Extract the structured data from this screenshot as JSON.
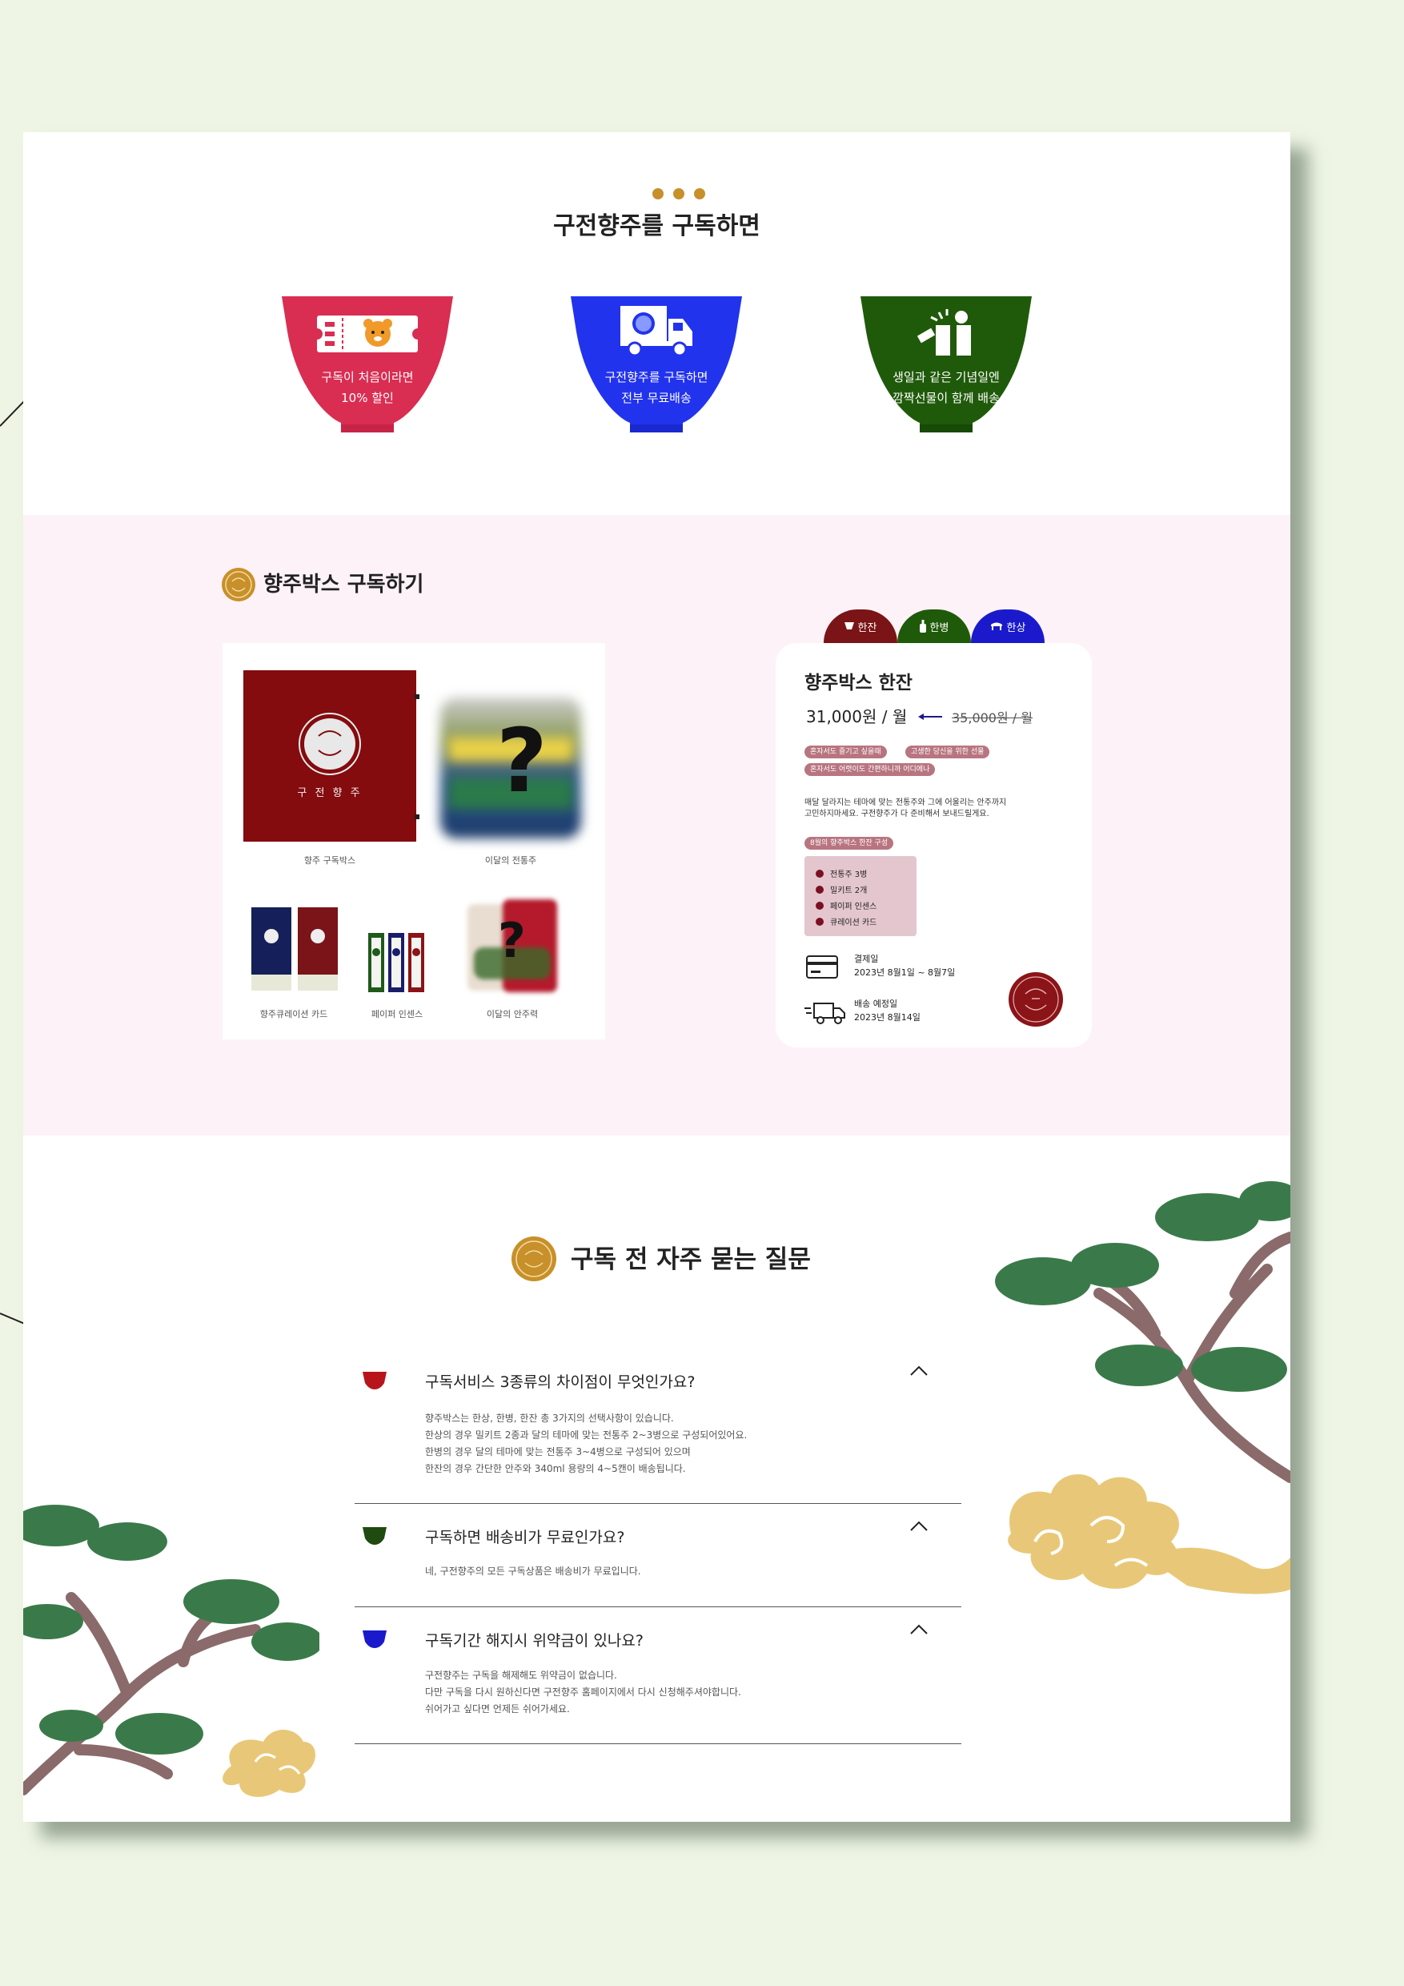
{
  "benefits": {
    "title": "구전향주를 구독하면",
    "items": [
      {
        "line1": "구독이 처음이라면",
        "line2": "10% 할인",
        "color": "#d92d52",
        "icon": "coupon-icon"
      },
      {
        "line1": "구전향주를 구독하면",
        "line2": "전부 무료배송",
        "color": "#2233ee",
        "icon": "delivery-truck-icon"
      },
      {
        "line1": "생일과 같은 기념일엔",
        "line2": "깜짝선물이 함께 배송",
        "color": "#1f5a0a",
        "icon": "gift-icon"
      }
    ]
  },
  "subscribe": {
    "title": "향주박스 구독하기",
    "box_brand": "구 전 향 주",
    "products": {
      "box": "향주 구독박스",
      "drinks": "이달의 전통주",
      "card": "향주큐레이션 카드",
      "paper": "페이퍼 인센스",
      "snacks": "이달의 안주력"
    },
    "tabs": [
      {
        "label": "한잔",
        "color": "#7a1416",
        "icon": "cup-icon"
      },
      {
        "label": "한병",
        "color": "#1f5a0a",
        "icon": "bottle-icon"
      },
      {
        "label": "한상",
        "color": "#1a1acc",
        "icon": "table-icon"
      }
    ],
    "plan": {
      "name": "향주박스 한잔",
      "price": "31,000원 / 월",
      "old_price": "35,000원 / 월",
      "chips": [
        "혼자서도 즐기고 싶을때",
        "고생한 당신을 위한 선물",
        "혼자서도 어렷이도 간편하니까 어디에나"
      ],
      "desc": [
        "매달 달라지는 테마에 맞는 전통주와 그에 어울리는 안주까지",
        "고민하지마세요. 구전향주가 다 준비해서 보내드릴게요."
      ],
      "compo_title": "8월의 향주박스 한잔 구성",
      "compo": [
        "전통주 3병",
        "밀키트 2개",
        "페이퍼 인센스",
        "큐레이션 카드"
      ],
      "pay_label": "결제일",
      "pay_date": "2023년 8월1일 ~ 8월7일",
      "ship_label": "배송 예정일",
      "ship_date": "2023년 8월14일"
    }
  },
  "faq": {
    "title": "구독 전 자주 묻는 질문",
    "items": [
      {
        "q": "구독서비스 3종류의 차이점이 무엇인가요?",
        "color": "#b8141c",
        "a": [
          "향주박스는 한상, 한병, 한잔 총 3가지의 선택사항이 있습니다.",
          "한상의 경우 밀키트 2종과 달의 테마에 맞는 전통주 2~3병으로 구성되어있어요.",
          "한병의 경우 달의 테마에 맞는 전통주 3~4병으로 구성되어 있으며",
          "한잔의 경우 간단한 안주와 340ml 용량의 4~5캔이 배송됩니다."
        ]
      },
      {
        "q": "구독하면 배송비가 무료인가요?",
        "color": "#1f4a10",
        "a": [
          "네, 구전향주의 모든 구독상품은 배송비가 무료입니다."
        ]
      },
      {
        "q": "구독기간 해지시 위약금이 있나요?",
        "color": "#1a1acc",
        "a": [
          "구전향주는 구독을 해제해도 위약금이 없습니다.",
          "다만 구독을 다시 원하신다면 구전향주 홈페이지에서 다시 신청해주셔야합니다.",
          "쉬어가고 싶다면 언제든 쉬어가세요."
        ]
      }
    ]
  }
}
